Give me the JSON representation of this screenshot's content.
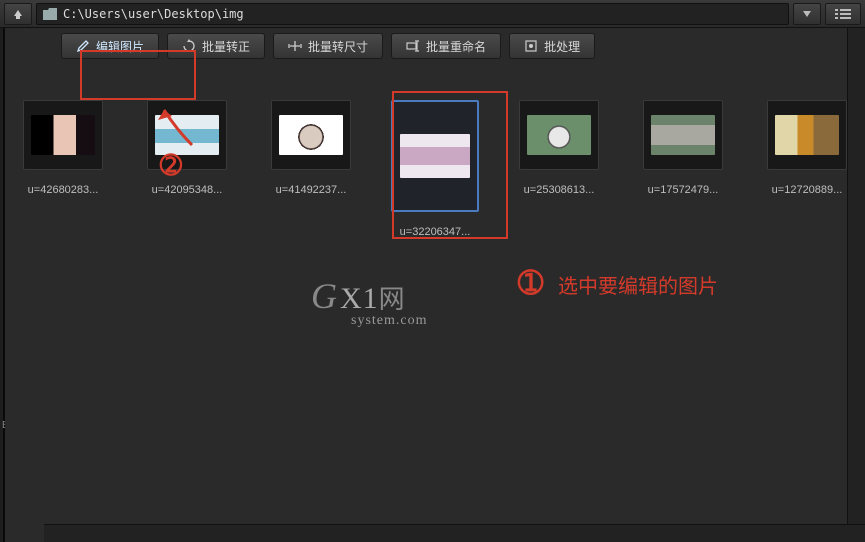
{
  "titlebar": {
    "path": "C:\\Users\\user\\Desktop\\img"
  },
  "toolbar": {
    "edit_label": "编辑图片",
    "batch_rotate": "批量转正",
    "batch_resize": "批量转尺寸",
    "batch_rename": "批量重命名",
    "batch_process": "批处理"
  },
  "thumbs": [
    {
      "name": "u=42680283..."
    },
    {
      "name": "u=42095348..."
    },
    {
      "name": "u=41492237..."
    },
    {
      "name": "u=32206347..."
    },
    {
      "name": "u=25308613..."
    },
    {
      "name": "u=17572479..."
    },
    {
      "name": "u=12720889..."
    }
  ],
  "watermark": {
    "brand": "G",
    "x1": "X1",
    "net": "网",
    "sub": "system.com"
  },
  "annotations": {
    "step2": "➁",
    "step1": "➀",
    "select_text": "选中要编辑的图片"
  },
  "sidebar": {
    "box_label": "Box"
  }
}
